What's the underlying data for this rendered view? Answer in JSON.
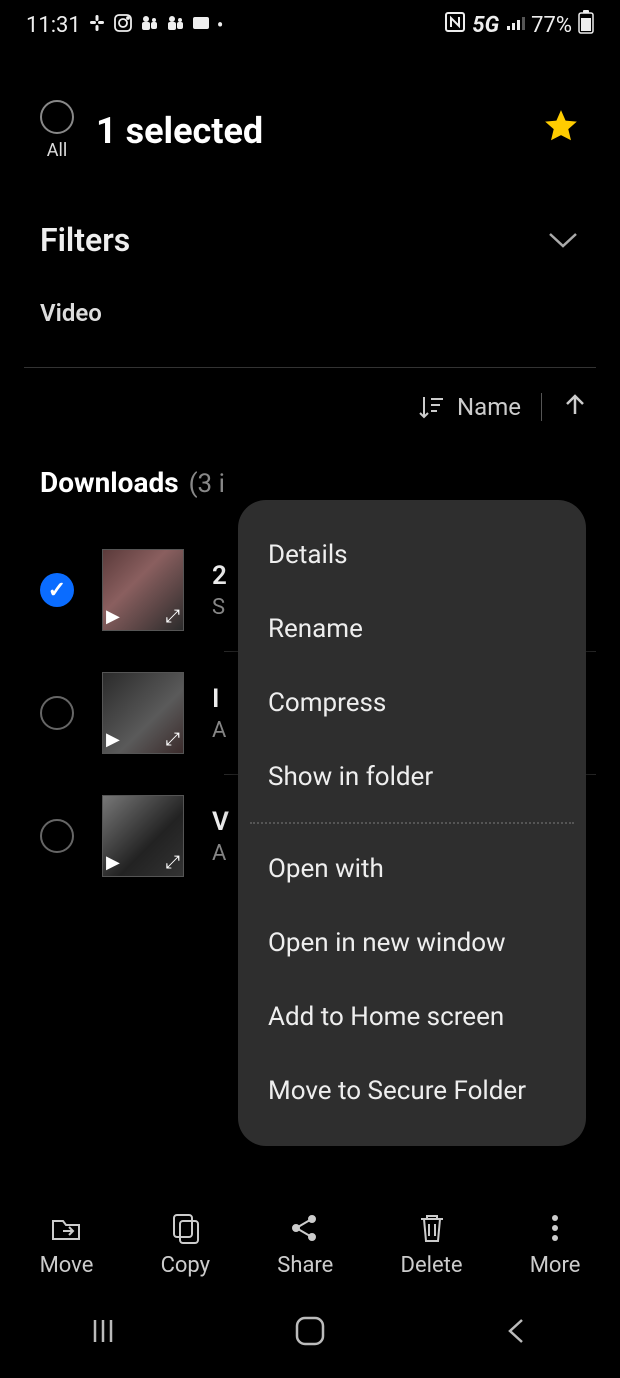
{
  "status": {
    "time": "11:31",
    "network": "5G",
    "battery": "77%"
  },
  "header": {
    "all_label": "All",
    "selected_title": "1 selected"
  },
  "filters": {
    "label": "Filters",
    "type": "Video"
  },
  "sort": {
    "label": "Name"
  },
  "downloads": {
    "title": "Downloads",
    "count_partial": "(3 i"
  },
  "files": [
    {
      "checked": true,
      "name_partial": "2",
      "sub_partial": "S"
    },
    {
      "checked": false,
      "name_partial": "I",
      "sub_partial": "A"
    },
    {
      "checked": false,
      "name_partial": "V",
      "sub_partial": "A"
    }
  ],
  "menu": {
    "details": "Details",
    "rename": "Rename",
    "compress": "Compress",
    "show_in_folder": "Show in folder",
    "open_with": "Open with",
    "open_new_window": "Open in new window",
    "add_home": "Add to Home screen",
    "secure_folder": "Move to Secure Folder"
  },
  "actions": {
    "move": "Move",
    "copy": "Copy",
    "share": "Share",
    "delete": "Delete",
    "more": "More"
  }
}
